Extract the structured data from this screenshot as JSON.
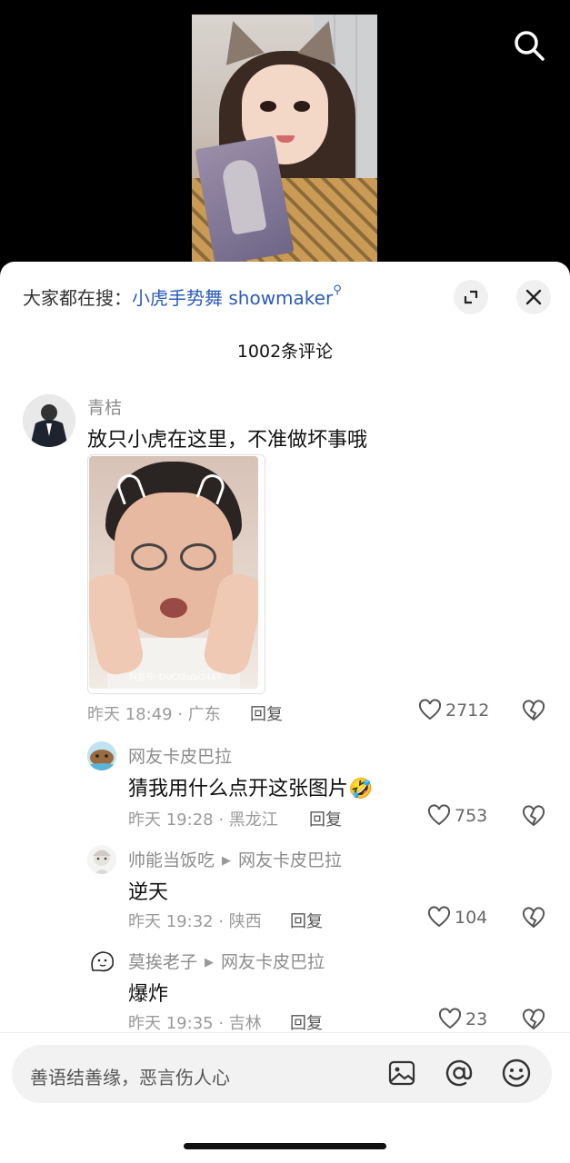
{
  "hot_search": {
    "prefix": "大家都在搜：",
    "keyword": "小虎手势舞 showmaker",
    "icon": "search-icon"
  },
  "comments_header": {
    "count_label": "1002条评论"
  },
  "comments": [
    {
      "username": "青桔",
      "text": "放只小虎在这里，不准做坏事哦",
      "time_location": "昨天 18:49 · 广东",
      "reply_label": "回复",
      "likes": "2712",
      "image_watermark": "抖音号: DUCKbubi2443"
    }
  ],
  "replies": [
    {
      "username": "网友卡皮巴拉",
      "reply_to": "",
      "text": "猜我用什么点开这张图片🤣",
      "time_location": "昨天 19:28 · 黑龙江",
      "reply_label": "回复",
      "likes": "753"
    },
    {
      "username": "帅能当饭吃",
      "reply_to": "网友卡皮巴拉",
      "text": "逆天",
      "time_location": "昨天 19:32 · 陕西",
      "reply_label": "回复",
      "likes": "104"
    },
    {
      "username": "莫挨老子",
      "reply_to": "网友卡皮巴拉",
      "text": "爆炸",
      "time_location": "昨天 19:35 · 吉林",
      "reply_label": "回复",
      "likes": "23"
    }
  ],
  "input": {
    "placeholder": "善语结善缘，恶言伤人心"
  },
  "icons": {
    "top": "search-icon",
    "sheet_expand": "expand-icon",
    "sheet_close": "close-icon",
    "like": "heart-icon",
    "dislike": "broken-heart-icon",
    "input_image": "image-icon",
    "input_mention": "at-icon",
    "input_emoji": "emoji-icon"
  },
  "colors": {
    "keyword": "#2b5bb9",
    "background": "#ffffff"
  }
}
